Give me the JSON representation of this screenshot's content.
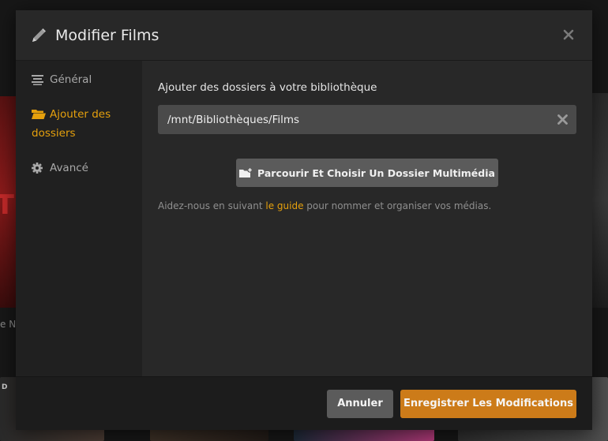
{
  "background": {
    "left_caption": "e Nc",
    "left_poster_letters": "ET",
    "thumb_label": "D"
  },
  "modal": {
    "title": "Modifier Films",
    "icons": {
      "title": "pencil-icon",
      "close": "close-icon"
    }
  },
  "sidebar": {
    "items": [
      {
        "label": "Général",
        "icon": "list-icon",
        "active": false
      },
      {
        "label": "Ajouter des dossiers",
        "icon": "folder-open-icon",
        "active": true
      },
      {
        "label": "Avancé",
        "icon": "gear-icon",
        "active": false
      }
    ]
  },
  "content": {
    "section_label": "Ajouter des dossiers à votre bibliothèque",
    "folder_path": "/mnt/Bibliothèques/Films",
    "browse_button_label": "Parcourir Et Choisir Un Dossier Multimédia",
    "help_prefix": "Aidez-nous en suivant ",
    "help_link": "le guide",
    "help_suffix": " pour nommer et organiser vos médias."
  },
  "footer": {
    "cancel_label": "Annuler",
    "save_label": "Enregistrer Les Modifications"
  },
  "colors": {
    "accent": "#e5a00d",
    "save_button": "#cc7b19",
    "neutral_button": "#5b5b5b"
  }
}
